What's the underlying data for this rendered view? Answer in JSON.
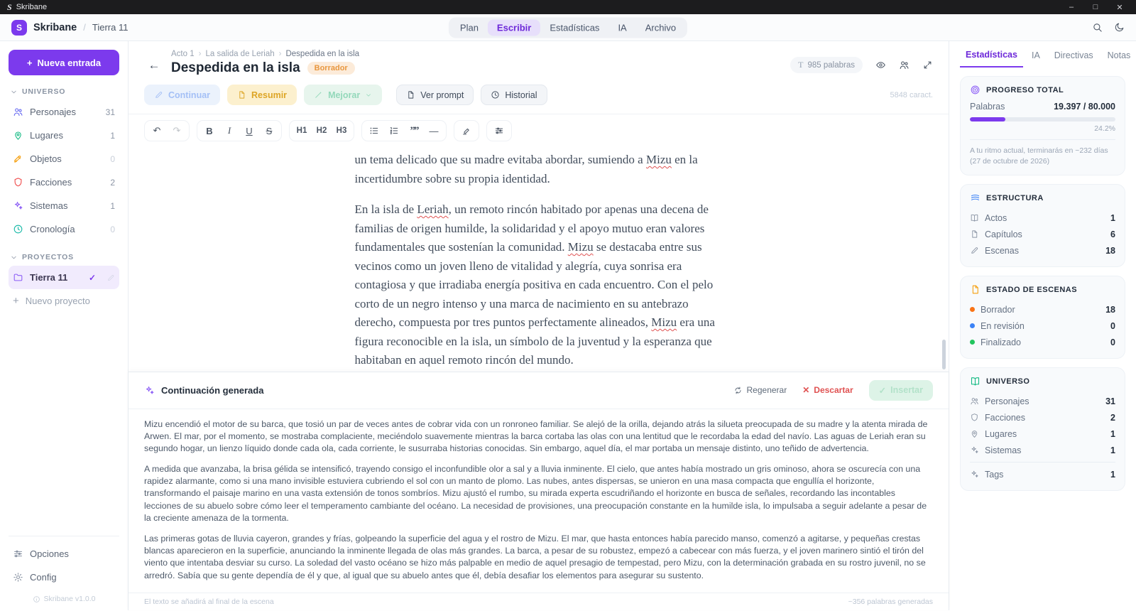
{
  "window": {
    "app_title": "Skribane",
    "controls": {
      "minimize": "–",
      "maximize": "□",
      "close": "✕"
    }
  },
  "icons": {
    "back": "←",
    "plus": "+",
    "check": "✓",
    "close": "✕",
    "undo": "↶",
    "redo": "↷",
    "bold": "B",
    "italic": "I",
    "underline": "U",
    "strike": "S",
    "quote": "””",
    "divider": "—",
    "text": "T"
  },
  "header": {
    "logo_letter": "S",
    "app_name": "Skribane",
    "project_name": "Tierra 11",
    "nav": {
      "plan": "Plan",
      "escribir": "Escribir",
      "estadisticas": "Estadísticas",
      "ia": "IA",
      "archivo": "Archivo"
    }
  },
  "sidebar": {
    "new_entry": "Nueva entrada",
    "universo_title": "UNIVERSO",
    "universo_items": [
      {
        "label": "Personajes",
        "count": "31"
      },
      {
        "label": "Lugares",
        "count": "1"
      },
      {
        "label": "Objetos",
        "count": "0"
      },
      {
        "label": "Facciones",
        "count": "2"
      },
      {
        "label": "Sistemas",
        "count": "1"
      },
      {
        "label": "Cronología",
        "count": "0"
      }
    ],
    "proyectos_title": "PROYECTOS",
    "active_project": "Tierra 11",
    "new_project": "Nuevo proyecto",
    "opciones": "Opciones",
    "config": "Config",
    "version": "Skribane v1.0.0"
  },
  "editor": {
    "breadcrumb": [
      "Acto 1",
      "La salida de Leriah",
      "Despedida en la isla"
    ],
    "title": "Despedida en la isla",
    "badge": "Borrador",
    "word_count": "985 palabras",
    "char_count": "5848 caract.",
    "actions": {
      "continuar": "Continuar",
      "resumir": "Resumir",
      "mejorar": "Mejorar",
      "ver_prompt": "Ver prompt",
      "historial": "Historial"
    },
    "toolbar": {
      "h1": "H1",
      "h2": "H2",
      "h3": "H3"
    },
    "misspelled": [
      "Mizu",
      "Leriah"
    ],
    "paragraphs": [
      "un tema delicado que su madre evitaba abordar, sumiendo a Mizu en la incertidumbre sobre su propia identidad.",
      "En la isla de Leriah, un remoto rincón habitado por apenas una decena de familias de origen humilde, la solidaridad y el apoyo mutuo eran valores fundamentales que sostenían la comunidad. Mizu se destacaba entre sus vecinos como un joven lleno de vitalidad y alegría, cuya sonrisa era contagiosa y que irradiaba energía positiva en cada encuentro. Con el pelo corto de un negro intenso y una marca de nacimiento en su antebrazo derecho, compuesta por tres puntos perfectamente alineados, Mizu era una figura reconocible en la isla, un símbolo de la juventud y la esperanza que habitaban en aquel remoto rincón del mundo."
    ]
  },
  "ai_panel": {
    "title": "Continuación generada",
    "regenerar": "Regenerar",
    "descartar": "Descartar",
    "insertar": "Insertar",
    "paragraphs": [
      "Mizu encendió el motor de su barca, que tosió un par de veces antes de cobrar vida con un ronroneo familiar. Se alejó de la orilla, dejando atrás la silueta preocupada de su madre y la atenta mirada de Arwen. El mar, por el momento, se mostraba complaciente, meciéndolo suavemente mientras la barca cortaba las olas con una lentitud que le recordaba la edad del navío. Las aguas de Leriah eran su segundo hogar, un lienzo líquido donde cada ola, cada corriente, le susurraba historias conocidas. Sin embargo, aquel día, el mar portaba un mensaje distinto, uno teñido de advertencia.",
      "A medida que avanzaba, la brisa gélida se intensificó, trayendo consigo el inconfundible olor a sal y a lluvia inminente. El cielo, que antes había mostrado un gris ominoso, ahora se oscurecía con una rapidez alarmante, como si una mano invisible estuviera cubriendo el sol con un manto de plomo. Las nubes, antes dispersas, se unieron en una masa compacta que engullía el horizonte, transformando el paisaje marino en una vasta extensión de tonos sombríos. Mizu ajustó el rumbo, su mirada experta escudriñando el horizonte en busca de señales, recordando las incontables lecciones de su abuelo sobre cómo leer el temperamento cambiante del océano. La necesidad de provisiones, una preocupación constante en la humilde isla, lo impulsaba a seguir adelante a pesar de la creciente amenaza de la tormenta.",
      "Las primeras gotas de lluvia cayeron, grandes y frías, golpeando la superficie del agua y el rostro de Mizu. El mar, que hasta entonces había parecido manso, comenzó a agitarse, y pequeñas crestas blancas aparecieron en la superficie, anunciando la inminente llegada de olas más grandes. La barca, a pesar de su robustez, empezó a cabecear con más fuerza, y el joven marinero sintió el tirón del viento que intentaba desviar su curso. La soledad del vasto océano se hizo más palpable en medio de aquel presagio de tempestad, pero Mizu, con la determinación grabada en su rostro juvenil, no se arredró. Sabía que su gente dependía de él y que, al igual que su abuelo antes que él, debía desafiar los elementos para asegurar su sustento."
    ],
    "footer_note": "El texto se añadirá al final de la escena",
    "generated_count": "~356 palabras generadas"
  },
  "stats": {
    "tabs": [
      "Estadísticas",
      "IA",
      "Directivas",
      "Notas"
    ],
    "progress": {
      "title": "PROGRESO TOTAL",
      "label": "Palabras",
      "value": "19.397 / 80.000",
      "percent": "24.2%",
      "percent_value": 24.2,
      "note": "A tu ritmo actual, terminarás en ~232 días (27 de octubre de 2026)"
    },
    "estructura": {
      "title": "ESTRUCTURA",
      "rows": [
        {
          "label": "Actos",
          "value": "1"
        },
        {
          "label": "Capítulos",
          "value": "6"
        },
        {
          "label": "Escenas",
          "value": "18"
        }
      ]
    },
    "estado": {
      "title": "ESTADO DE ESCENAS",
      "rows": [
        {
          "label": "Borrador",
          "value": "18",
          "color": "#f97316"
        },
        {
          "label": "En revisión",
          "value": "0",
          "color": "#3b82f6"
        },
        {
          "label": "Finalizado",
          "value": "0",
          "color": "#22c55e"
        }
      ]
    },
    "universo": {
      "title": "UNIVERSO",
      "rows": [
        {
          "label": "Personajes",
          "value": "31"
        },
        {
          "label": "Facciones",
          "value": "2"
        },
        {
          "label": "Lugares",
          "value": "1"
        },
        {
          "label": "Sistemas",
          "value": "1"
        },
        {
          "label": "Tags",
          "value": "1"
        }
      ]
    }
  },
  "colors": {
    "accent": "#7c3aed",
    "badge": "#e8973f",
    "draft_dot": "#f97316",
    "review_dot": "#3b82f6",
    "final_dot": "#22c55e"
  }
}
